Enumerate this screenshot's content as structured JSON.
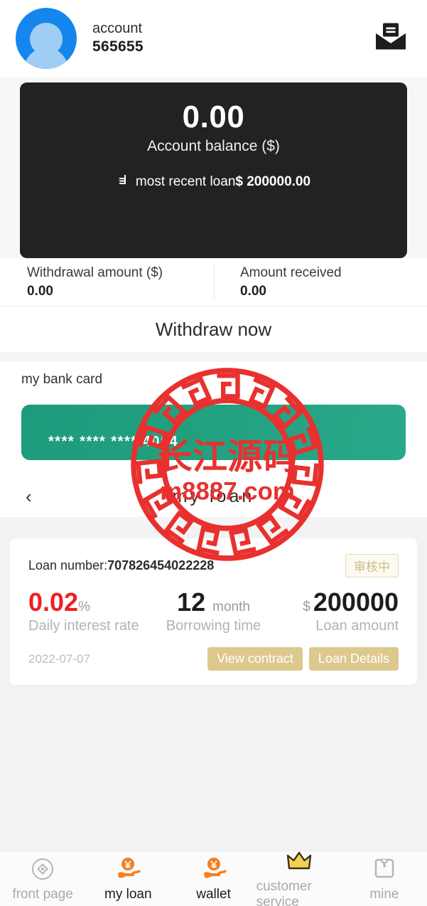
{
  "header": {
    "account_label": "account",
    "account_id": "565655",
    "avatar_icon": "user-avatar-icon",
    "mail_icon": "open-envelope-mail-icon"
  },
  "balance_card": {
    "amount": "0.00",
    "label": "Account balance ($)",
    "recent_icon": "stacked-coins-icon",
    "recent_prefix": "most recent loan",
    "recent_value": "$ 200000.00",
    "background_color": "#222222"
  },
  "withdraw": {
    "left_label": "Withdrawal amount ($)",
    "left_value": "0.00",
    "right_label": "Amount received",
    "right_value": "0.00",
    "button_label": "Withdraw now"
  },
  "bank": {
    "section_title": "my bank card",
    "card_number": "**** **** **** 4004",
    "card_color": "#1e9b7c"
  },
  "loan_header": {
    "back_icon": "chevron-left-icon",
    "title": "my loan"
  },
  "loan_card": {
    "loan_number_label": "Loan number:",
    "loan_number": "707826454022228",
    "status": "审核中",
    "rate_value": "0.02",
    "rate_unit": "%",
    "rate_caption": "Daily interest rate",
    "rate_color": "#ee1f21",
    "term_value": "12",
    "term_unit": "month",
    "term_caption": "Borrowing time",
    "amount_currency": "$",
    "amount_value": "200000",
    "amount_caption": "Loan amount",
    "date": "2022-07-07",
    "view_contract_label": "View contract",
    "loan_details_label": "Loan Details",
    "button_color": "#ddc88d"
  },
  "watermark": {
    "text_cn": "长江源码",
    "text_url": "m8887.com",
    "color": "#e8312f"
  },
  "tabbar": {
    "items": [
      {
        "label": "front page",
        "icon": "diamond-circle-icon",
        "active": false
      },
      {
        "label": "my loan",
        "icon": "hand-yuan-coin-icon",
        "active": true
      },
      {
        "label": "wallet",
        "icon": "hand-yuan-coin-icon",
        "active": true
      },
      {
        "label": "customer service",
        "icon": "crown-icon",
        "active": false
      },
      {
        "label": "mine",
        "icon": "wallet-bag-icon",
        "active": false
      }
    ]
  }
}
